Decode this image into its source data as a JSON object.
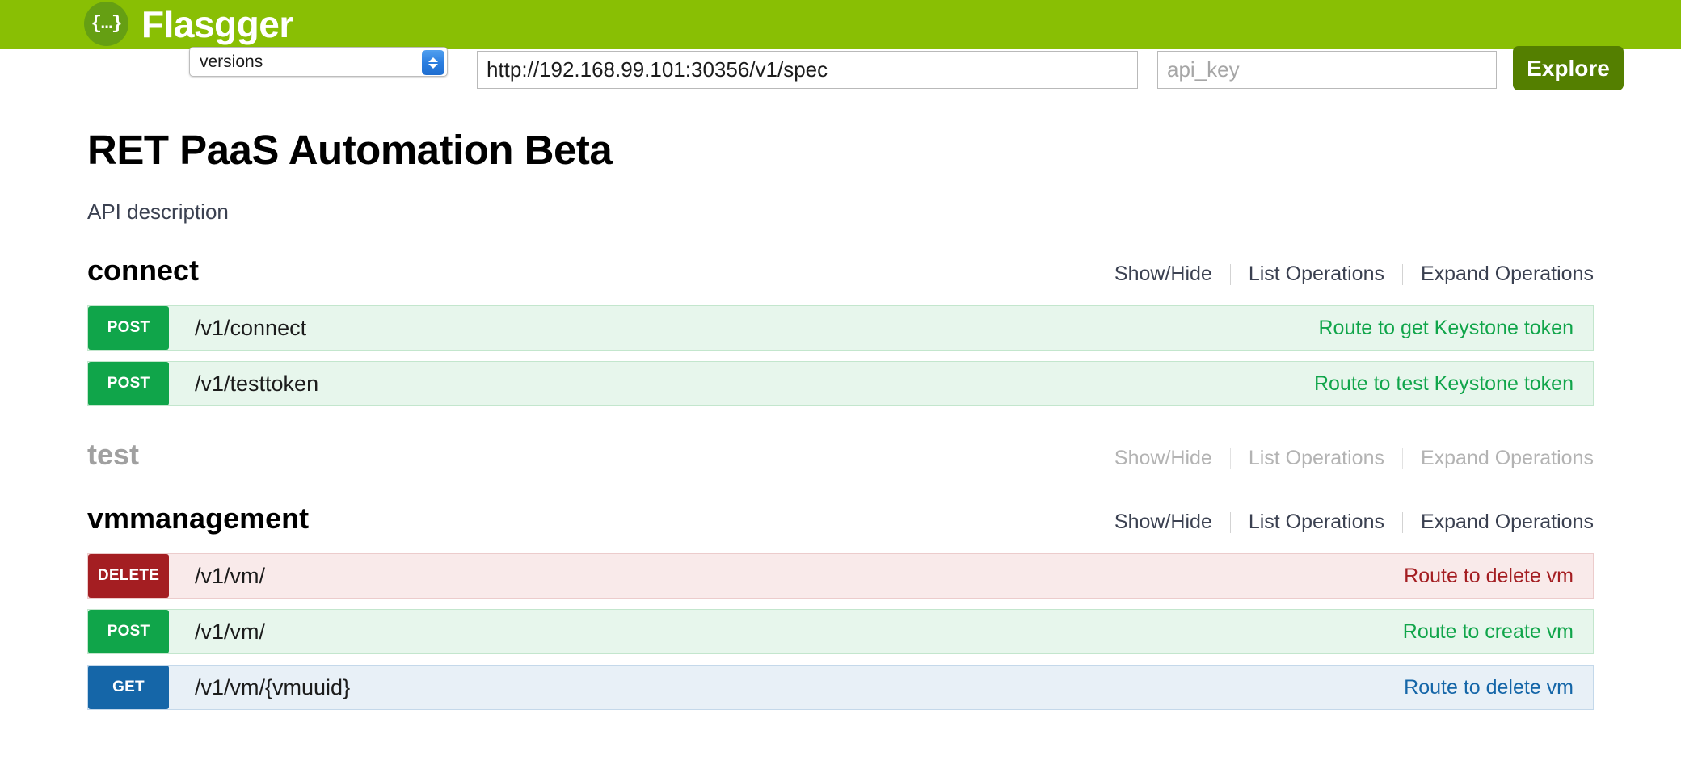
{
  "header": {
    "brand": "Flasgger",
    "logo_glyph": "{…}",
    "brand_color": "#89bf04",
    "logo_bg": "#659f13",
    "version_select_value": "versions",
    "url_value": "http://192.168.99.101:30356/v1/spec",
    "api_key_placeholder": "api_key",
    "api_key_value": "",
    "explore_label": "Explore",
    "explore_color": "#547f00"
  },
  "info": {
    "title": "RET PaaS Automation Beta",
    "description": "API description"
  },
  "links": {
    "show_hide": "Show/Hide",
    "list_operations": "List Operations",
    "expand_operations": "Expand Operations"
  },
  "resources": [
    {
      "name": "connect",
      "muted": false,
      "operations": [
        {
          "method": "POST",
          "path": "/v1/connect",
          "description": "Route to get Keystone token",
          "color": "#10a54a"
        },
        {
          "method": "POST",
          "path": "/v1/testtoken",
          "description": "Route to test Keystone token",
          "color": "#10a54a"
        }
      ]
    },
    {
      "name": "test",
      "muted": true,
      "operations": []
    },
    {
      "name": "vmmanagement",
      "muted": false,
      "operations": [
        {
          "method": "DELETE",
          "path": "/v1/vm/",
          "description": "Route to delete vm",
          "color": "#a41e22"
        },
        {
          "method": "POST",
          "path": "/v1/vm/",
          "description": "Route to create vm",
          "color": "#10a54a"
        },
        {
          "method": "GET",
          "path": "/v1/vm/{vmuuid}",
          "description": "Route to delete vm",
          "color": "#1566a8"
        }
      ]
    }
  ]
}
